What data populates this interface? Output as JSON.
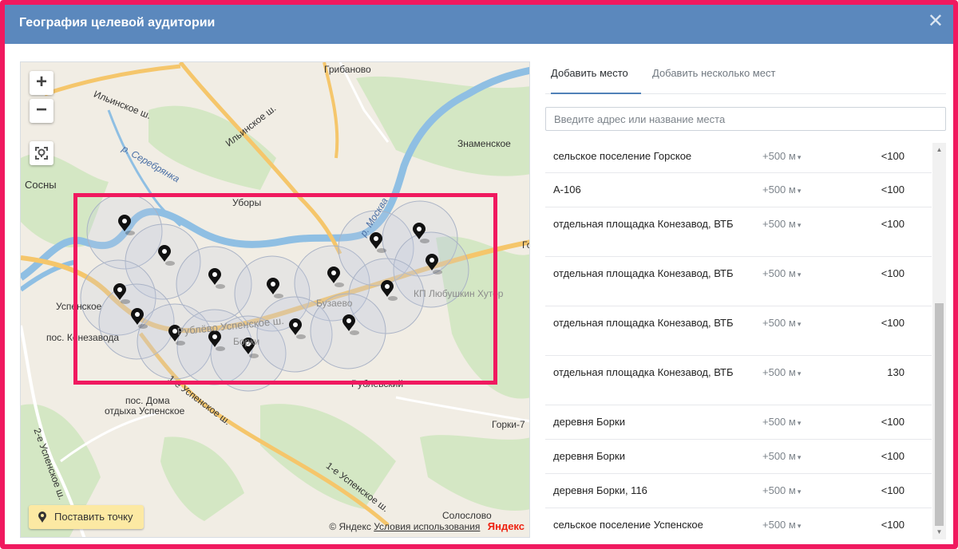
{
  "modal": {
    "title": "География целевой аудитории",
    "close": "✕"
  },
  "map": {
    "labels": [
      {
        "text": "Грибаново",
        "cls": ""
      },
      {
        "text": "Ильинское ш.",
        "cls": ""
      },
      {
        "text": "Ильинское ш.",
        "cls": ""
      },
      {
        "text": "Знаменское",
        "cls": ""
      },
      {
        "text": "р. Серебрянка",
        "cls": "italic"
      },
      {
        "text": "Сосны",
        "cls": ""
      },
      {
        "text": "Уборы",
        "cls": ""
      },
      {
        "text": "р. Москва",
        "cls": "italic"
      },
      {
        "text": "Го",
        "cls": ""
      },
      {
        "text": "КП Любушкин Хутор",
        "cls": "faint"
      },
      {
        "text": "Бузаево",
        "cls": "faint"
      },
      {
        "text": "Успенское",
        "cls": ""
      },
      {
        "text": "пос. Конезавода",
        "cls": ""
      },
      {
        "text": "Рублёво Успенское ш.",
        "cls": "faint"
      },
      {
        "text": "Борки",
        "cls": "faint"
      },
      {
        "text": "Рублевский",
        "cls": ""
      },
      {
        "text": "пос. Дома",
        "cls": ""
      },
      {
        "text": "отдыха Успенское",
        "cls": ""
      },
      {
        "text": "1-е Успенское ш.",
        "cls": ""
      },
      {
        "text": "2-е Успенское ш.",
        "cls": ""
      },
      {
        "text": "1-е Успенское ш.",
        "cls": ""
      },
      {
        "text": "Горки-7",
        "cls": ""
      },
      {
        "text": "Солослово",
        "cls": ""
      }
    ],
    "zoom_in": "+",
    "zoom_out": "−",
    "place_point_button": "Поставить точку",
    "copyright": "© Яндекс",
    "terms": "Условия использования",
    "logo": "Яндекс",
    "colors": {
      "highlight": "#f0195f",
      "river": "#7fb4da",
      "road": "#f5c66b",
      "forest": "#d4e7c4"
    }
  },
  "tabs": [
    {
      "label": "Добавить место",
      "active": true
    },
    {
      "label": "Добавить несколько мест",
      "active": false
    }
  ],
  "search": {
    "placeholder": "Введите адрес или название места"
  },
  "places": [
    {
      "name": "сельское поселение Горское",
      "radius": "+500 м",
      "count": "<100"
    },
    {
      "name": "А-106",
      "radius": "+500 м",
      "count": "<100"
    },
    {
      "name": "отдельная площадка Конезавод, ВТБ",
      "radius": "+500 м",
      "count": "<100"
    },
    {
      "name": "отдельная площадка Конезавод, ВТБ",
      "radius": "+500 м",
      "count": "<100"
    },
    {
      "name": "отдельная площадка Конезавод, ВТБ",
      "radius": "+500 м",
      "count": "<100"
    },
    {
      "name": "отдельная площадка Конезавод, ВТБ",
      "radius": "+500 м",
      "count": "130"
    },
    {
      "name": "деревня Борки",
      "radius": "+500 м",
      "count": "<100"
    },
    {
      "name": "деревня Борки",
      "radius": "+500 м",
      "count": "<100"
    },
    {
      "name": "деревня Борки, 116",
      "radius": "+500 м",
      "count": "<100"
    },
    {
      "name": "сельское поселение Успенское",
      "radius": "+500 м",
      "count": "<100"
    }
  ]
}
